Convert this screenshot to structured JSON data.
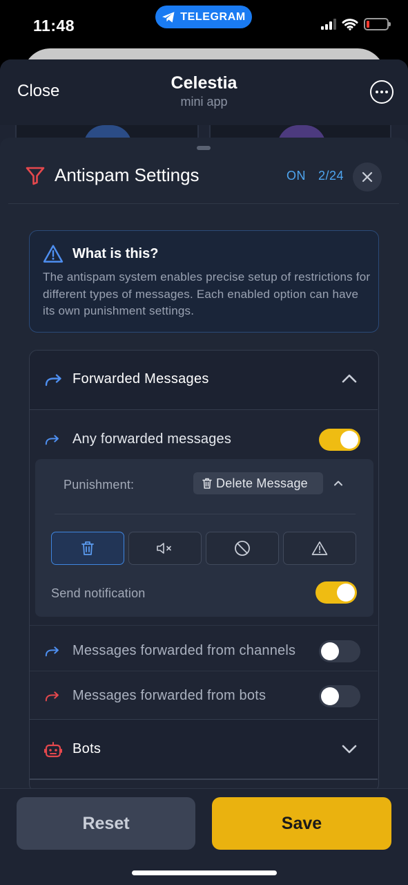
{
  "status_bar": {
    "time": "11:48",
    "pill_label": "TELEGRAM"
  },
  "tg_header": {
    "close_label": "Close",
    "title": "Celestia",
    "subtitle": "mini app"
  },
  "panel": {
    "title": "Antispam Settings",
    "status": "ON",
    "count": "2/24"
  },
  "info": {
    "title": "What is this?",
    "text": "The antispam system enables precise setup of restrictions for different types of messages. Each enabled option can have its own punishment settings."
  },
  "forwarded": {
    "title": "Forwarded Messages",
    "any": {
      "label": "Any forwarded messages",
      "enabled": true
    },
    "punishment": {
      "label": "Punishment:",
      "selected": "Delete Message",
      "actions": [
        "trash-icon",
        "mute-icon",
        "ban-icon",
        "warning-icon"
      ],
      "active_action": "trash-icon",
      "notification_label": "Send notification",
      "notification_enabled": true
    },
    "channels": {
      "label": "Messages forwarded from channels",
      "enabled": false
    },
    "bots": {
      "label": "Messages forwarded from bots",
      "enabled": false
    }
  },
  "bots_section": {
    "title": "Bots"
  },
  "footer": {
    "reset_label": "Reset",
    "save_label": "Save"
  },
  "colors": {
    "accent": "#efbc12",
    "link": "#4ea5ef",
    "danger": "#e5484d"
  }
}
